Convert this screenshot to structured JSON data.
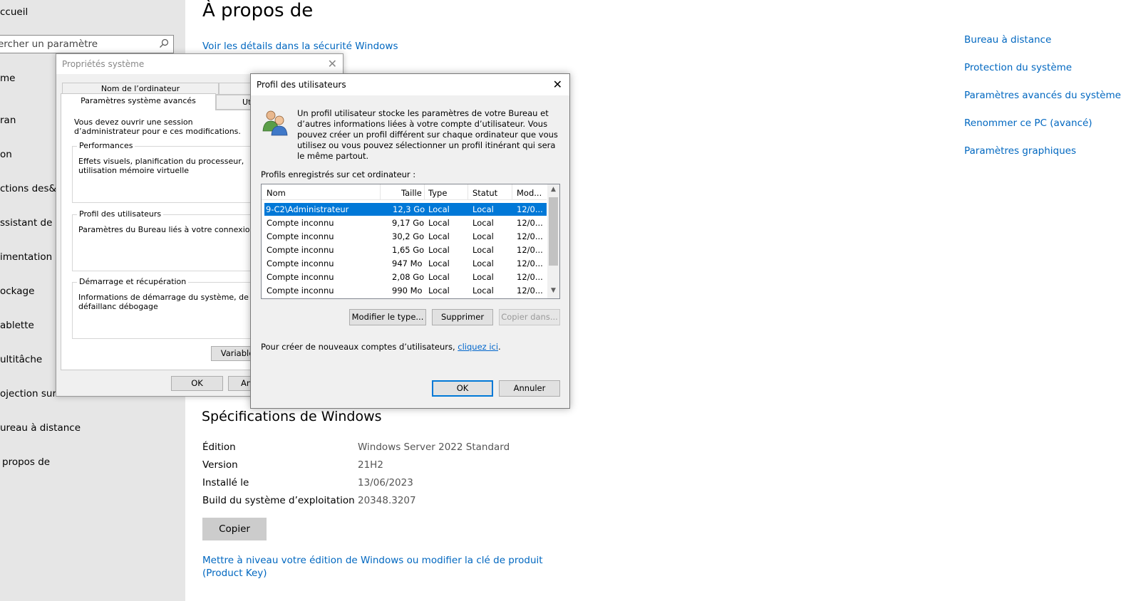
{
  "nav": {
    "items": [
      "ccueil",
      "me",
      "ran",
      "on",
      "ctions des& r",
      "ssistant de co",
      "imentation e",
      "ockage",
      "ablette",
      "ultitâche",
      "ojection sur c",
      "ureau à distance",
      "propos de"
    ],
    "search_placeholder": "ercher un paramètre"
  },
  "main": {
    "title": "À propos de",
    "security_link": "Voir les détails dans la sécurité Windows",
    "spec_title": "Spécifications de Windows",
    "specs": [
      {
        "k": "Édition",
        "v": "Windows Server 2022 Standard"
      },
      {
        "k": "Version",
        "v": "21H2"
      },
      {
        "k": "Installé le",
        "v": "13/06/2023"
      },
      {
        "k": "Build du système d’exploitation",
        "v": "20348.3207"
      }
    ],
    "copy_label": "Copier",
    "upgrade_link_line1": "Mettre à niveau votre édition de Windows ou modifier la clé de produit",
    "upgrade_link_line2": "(Product Key)"
  },
  "related": [
    "Bureau à distance",
    "Protection du système",
    "Paramètres avancés du système",
    "Renommer ce PC (avancé)",
    "Paramètres graphiques"
  ],
  "sysprops": {
    "title": "Propriétés système",
    "tabs": {
      "computer_name": "Nom de l’ordinateur",
      "advanced": "Paramètres système avancés",
      "other": "Uti"
    },
    "admin_note": "Vous devez ouvrir une session d’administrateur pour e ces modifications.",
    "perf_title": "Performances",
    "perf_body": "Effets visuels, planification du processeur, utilisation mémoire virtuelle",
    "profile_title": "Profil des utilisateurs",
    "profile_body": "Paramètres du Bureau liés à votre connexion",
    "startup_title": "Démarrage et récupération",
    "startup_body": "Informations de démarrage du système, de défaillanc débogage",
    "env_btn": "Variables",
    "ok": "OK",
    "cancel_partial": "An"
  },
  "profiles": {
    "title": "Profil des utilisateurs",
    "intro": "Un profil utilisateur stocke les paramètres de votre Bureau et d’autres informations liées à votre compte d’utilisateur. Vous pouvez créer un profil différent sur chaque ordinateur que vous utilisez ou vous pouvez sélectionner un profil itinérant qui sera le même partout.",
    "list_caption": "Profils enregistrés sur cet ordinateur :",
    "columns": {
      "name": "Nom",
      "size": "Taille",
      "type": "Type",
      "status": "Statut",
      "modified": "Mod..."
    },
    "rows": [
      {
        "name": "9-C2\\Administrateur",
        "size": "12,3 Go",
        "type": "Local",
        "status": "Local",
        "modified": "12/0..."
      },
      {
        "name": "Compte inconnu",
        "size": "9,17 Go",
        "type": "Local",
        "status": "Local",
        "modified": "12/0..."
      },
      {
        "name": "Compte inconnu",
        "size": "30,2 Go",
        "type": "Local",
        "status": "Local",
        "modified": "12/0..."
      },
      {
        "name": "Compte inconnu",
        "size": "1,65 Go",
        "type": "Local",
        "status": "Local",
        "modified": "12/0..."
      },
      {
        "name": "Compte inconnu",
        "size": "947 Mo",
        "type": "Local",
        "status": "Local",
        "modified": "12/0..."
      },
      {
        "name": "Compte inconnu",
        "size": "2,08 Go",
        "type": "Local",
        "status": "Local",
        "modified": "12/0..."
      },
      {
        "name": "Compte inconnu",
        "size": "990 Mo",
        "type": "Local",
        "status": "Local",
        "modified": "12/0..."
      }
    ],
    "btn_change_type": "Modifier le type...",
    "btn_delete": "Supprimer",
    "btn_copy_to": "Copier dans...",
    "create_text": "Pour créer de nouveaux comptes d’utilisateurs,",
    "create_link": "cliquez ici",
    "create_end": ".",
    "ok": "OK",
    "cancel": "Annuler"
  }
}
